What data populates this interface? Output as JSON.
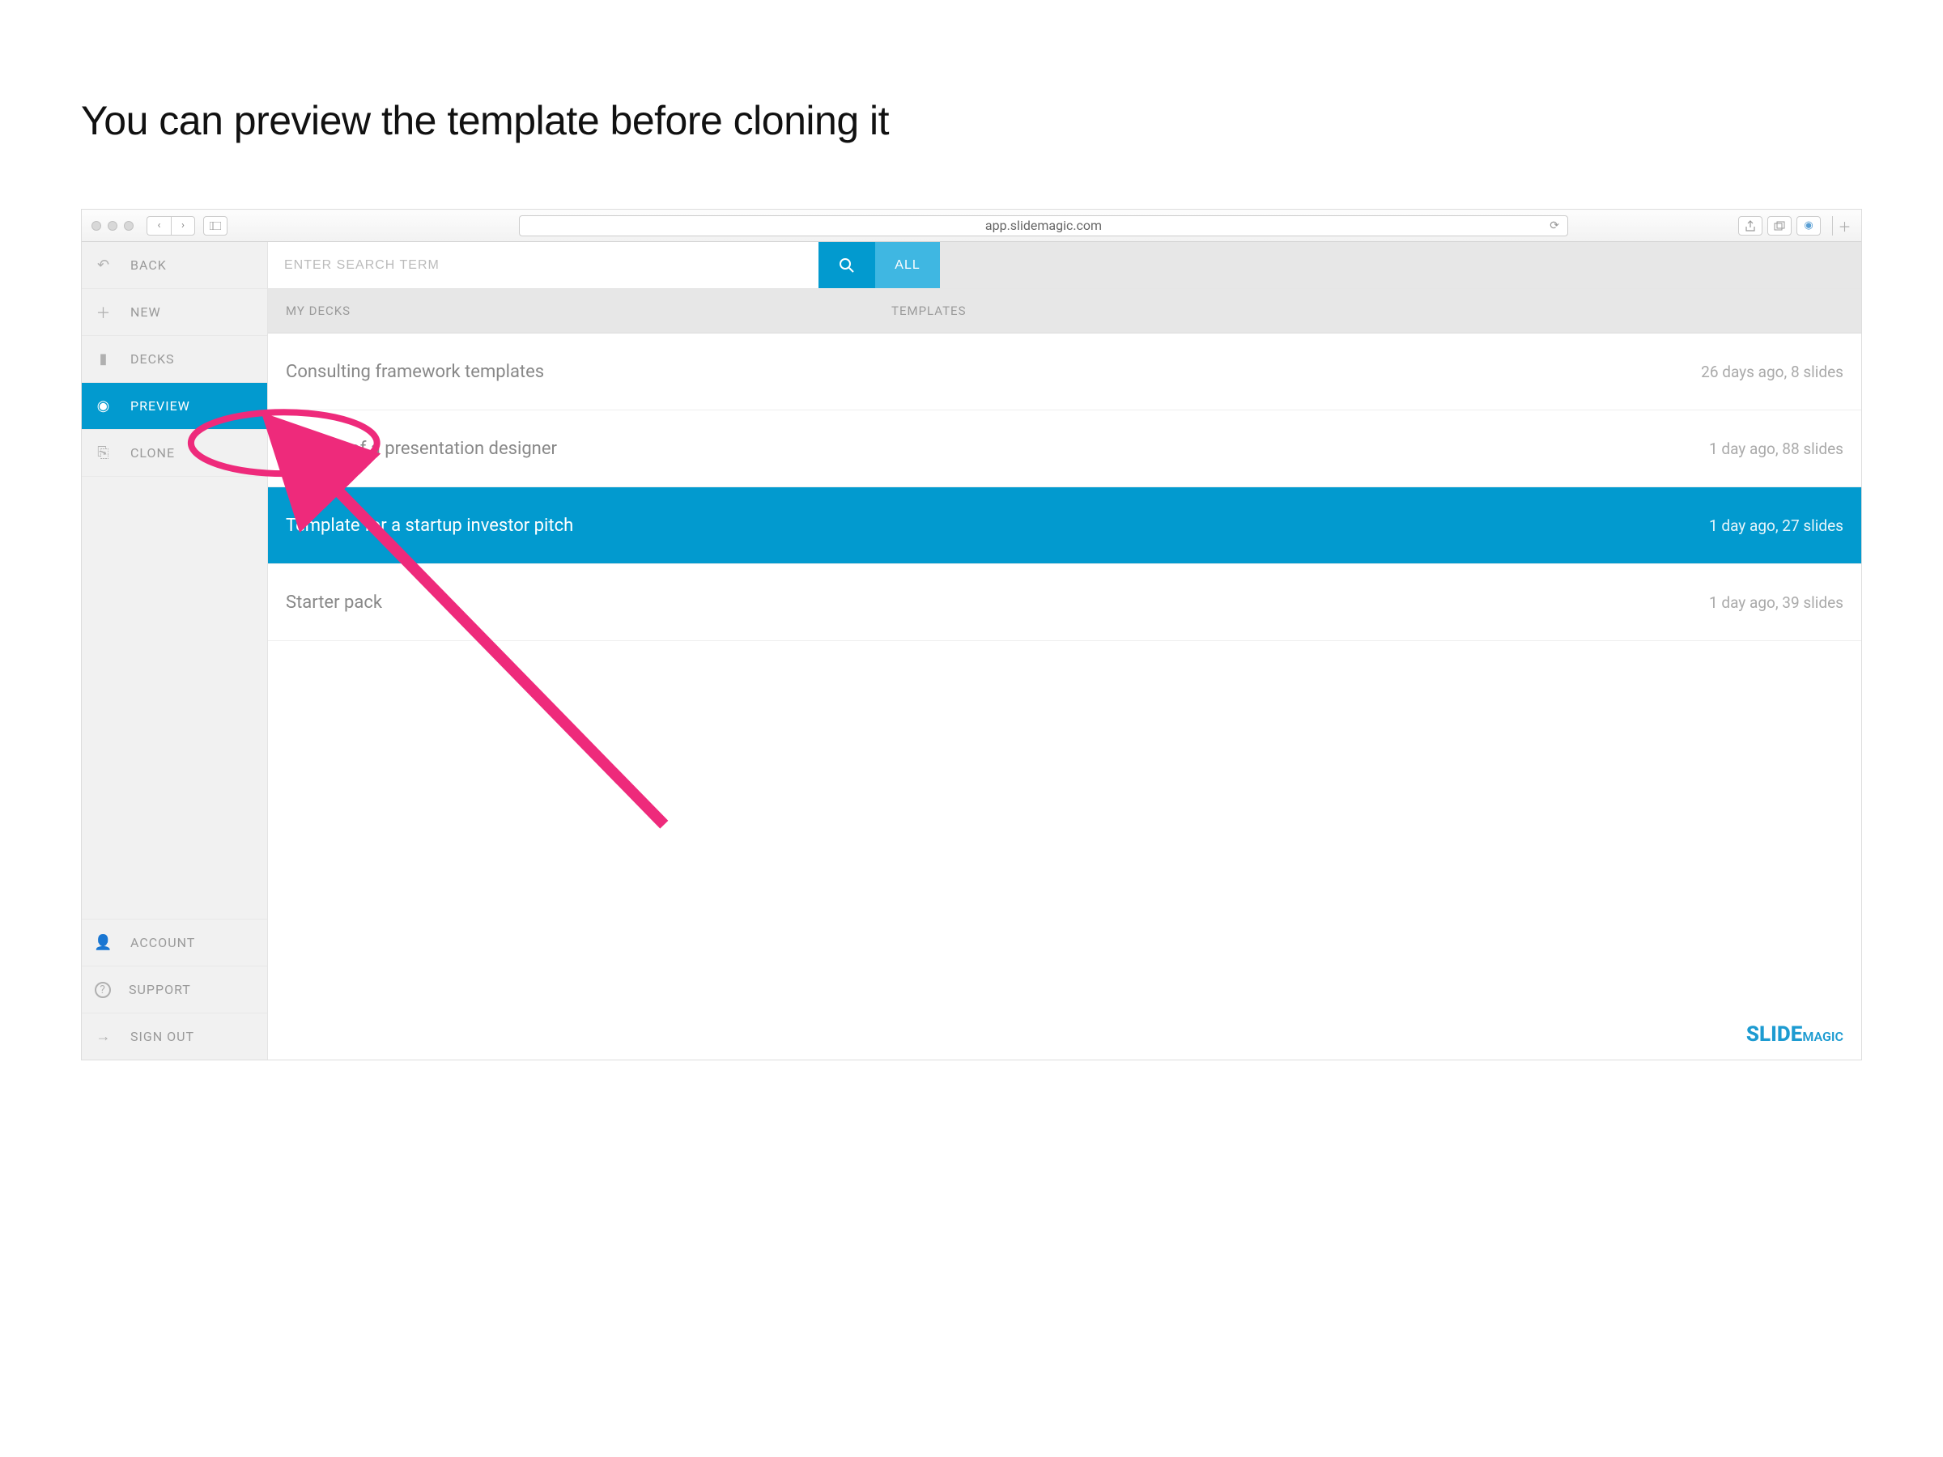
{
  "slide_heading": "You can preview the template before cloning it",
  "browser": {
    "url": "app.slidemagic.com"
  },
  "sidebar": {
    "top": [
      {
        "icon": "back-icon",
        "glyph": "↶",
        "label": "BACK"
      },
      {
        "icon": "plus-icon",
        "glyph": "＋",
        "label": "NEW"
      },
      {
        "icon": "folder-icon",
        "glyph": "▮",
        "label": "DECKS"
      },
      {
        "icon": "eye-icon",
        "glyph": "◉",
        "label": "PREVIEW",
        "active": true
      },
      {
        "icon": "clone-icon",
        "glyph": "⎘",
        "label": "CLONE"
      }
    ],
    "bottom": [
      {
        "icon": "user-icon",
        "glyph": "👤",
        "label": "ACCOUNT"
      },
      {
        "icon": "help-icon",
        "glyph": "?",
        "label": "SUPPORT"
      },
      {
        "icon": "signout-icon",
        "glyph": "→",
        "label": "SIGN OUT"
      }
    ]
  },
  "search": {
    "placeholder": "ENTER SEARCH TERM",
    "all_label": "ALL"
  },
  "tabs": {
    "mydecks": "MY DECKS",
    "templates": "TEMPLATES"
  },
  "templates": [
    {
      "title": "Consulting framework templates",
      "meta": "26 days ago, 8 slides"
    },
    {
      "title": "Secrets of a presentation designer",
      "meta": "1 day ago, 88 slides"
    },
    {
      "title": "Template for a startup investor pitch",
      "meta": "1 day ago, 27 slides",
      "selected": true
    },
    {
      "title": "Starter pack",
      "meta": "1 day ago, 39 slides"
    }
  ],
  "logo": {
    "main": "SLIDE",
    "sub": "MAGIC"
  }
}
